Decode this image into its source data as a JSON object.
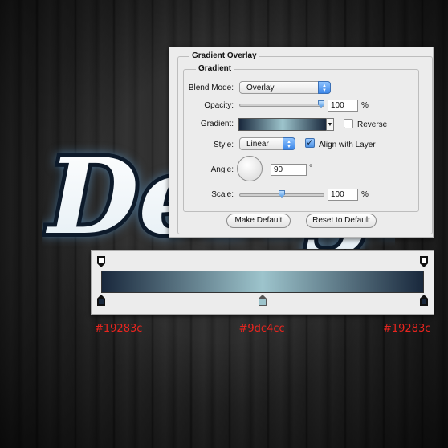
{
  "dialog": {
    "title": "Gradient Overlay",
    "section_title": "Gradient",
    "blend_mode": {
      "label": "Blend Mode:",
      "value": "Overlay"
    },
    "opacity": {
      "label": "Opacity:",
      "value": "100",
      "unit": "%",
      "level": 1.0
    },
    "gradient": {
      "label": "Gradient:",
      "reverse_label": "Reverse",
      "reverse_checked": false
    },
    "style": {
      "label": "Style:",
      "value": "Linear",
      "align_label": "Align with Layer",
      "align_checked": true
    },
    "angle": {
      "label": "Angle:",
      "value": "90",
      "unit": "°"
    },
    "scale": {
      "label": "Scale:",
      "value": "100",
      "unit": "%",
      "level": 0.5
    },
    "make_default_label": "Make Default",
    "reset_default_label": "Reset to Default"
  },
  "gradient_editor": {
    "stops": [
      {
        "color": "#19283c",
        "label": "#19283c",
        "location": 0
      },
      {
        "color": "#9dc4cc",
        "label": "#9dc4cc",
        "location": 50
      },
      {
        "color": "#19283c",
        "label": "#19283c",
        "location": 100
      }
    ]
  },
  "artwork": {
    "text": "Design"
  },
  "colors": {
    "dark": "#19283c",
    "light": "#9dc4cc",
    "annotation": "#e8251f"
  }
}
